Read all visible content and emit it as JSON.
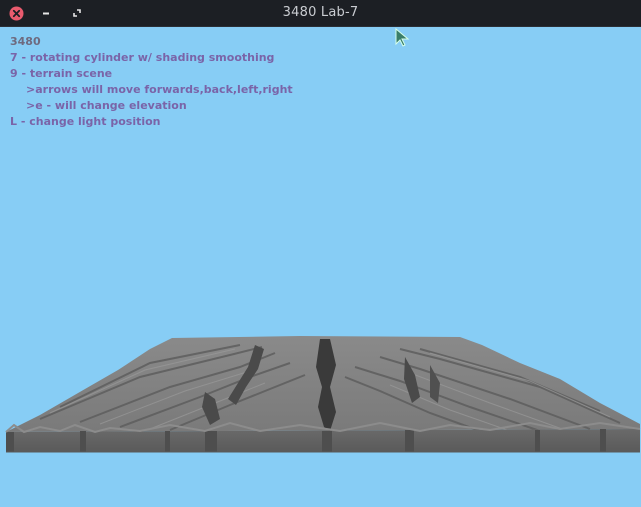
{
  "window": {
    "title": "3480 Lab-7"
  },
  "help": {
    "line0": "3480",
    "line1": "7 - rotating cylinder w/ shading smoothing",
    "line2": "9 - terrain scene",
    "line3": ">arrows will move forwards,back,left,right",
    "line4": ">e - will change elevation",
    "line5": "L - change light position"
  },
  "colors": {
    "sky": "#87cdf5",
    "titlebar": "#1c1f24",
    "help_text": "#7a64a8",
    "terrain": "#7d7d7d",
    "close": "#e95b6e"
  },
  "icons": {
    "close": "close-icon",
    "minimize": "minimize-icon",
    "maximize": "maximize-icon",
    "cursor": "mouse-cursor-icon"
  }
}
